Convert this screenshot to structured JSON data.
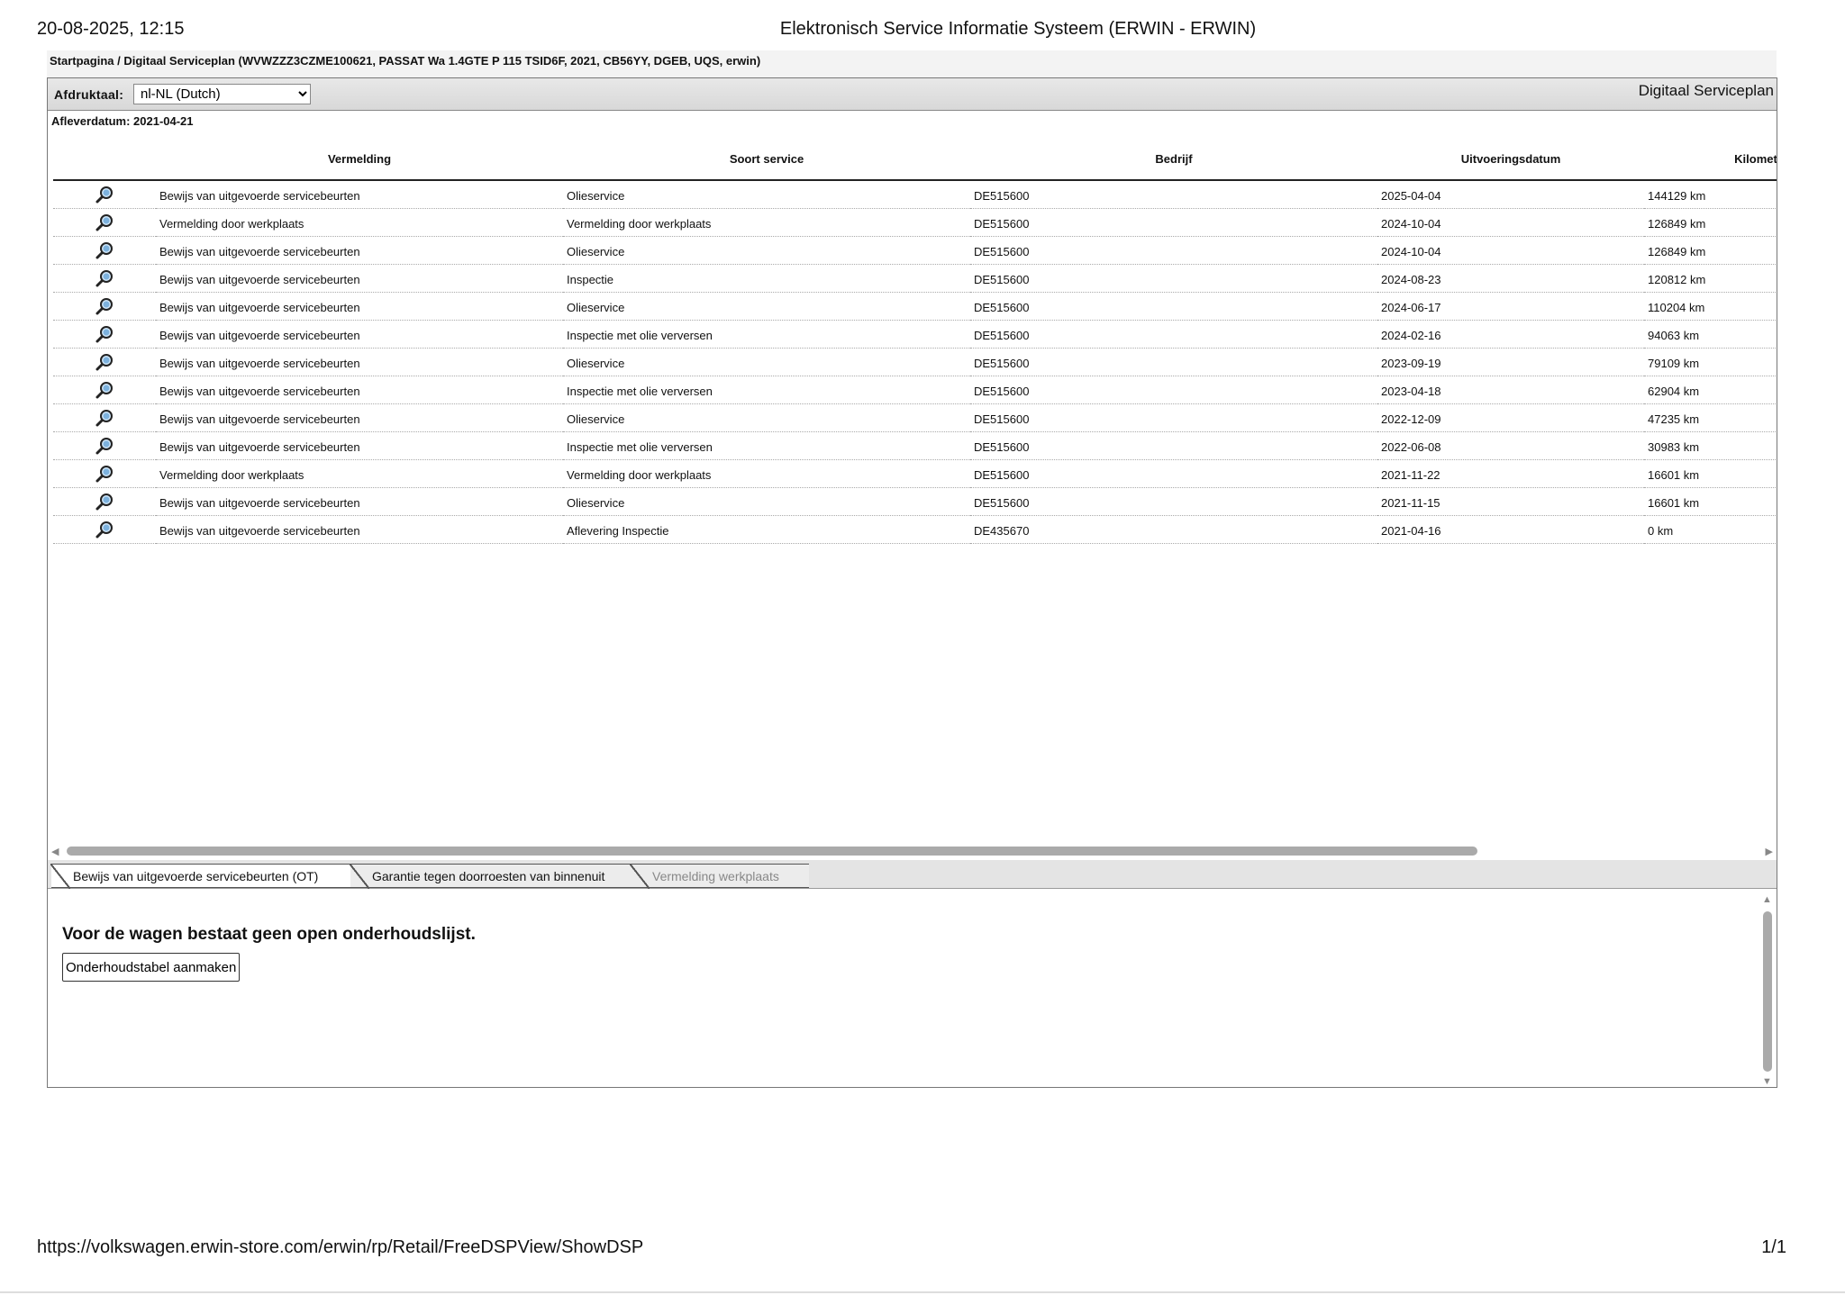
{
  "print_header": {
    "datetime": "20-08-2025, 12:15",
    "title": "Elektronisch Service Informatie Systeem (ERWIN - ERWIN)"
  },
  "breadcrumb": "Startpagina / Digitaal Serviceplan (WVWZZZ3CZME100621, PASSAT Wa 1.4GTE P 115 TSID6F, 2021, CB56YY, DGEB, UQS, erwin)",
  "toolbar": {
    "print_language_label": "Afdruktaal:",
    "print_language_value": "nl-NL (Dutch)",
    "panel_title": "Digitaal Serviceplan"
  },
  "delivery_date": "Afleverdatum: 2021-04-21",
  "table": {
    "columns": [
      "Vermelding",
      "Soort service",
      "Bedrijf",
      "Uitvoeringsdatum",
      "Kilometerstand"
    ],
    "rows": [
      {
        "entry": "Bewijs van uitgevoerde servicebeurten",
        "service_type": "Olieservice",
        "company": "DE515600",
        "date": "2025-04-04",
        "mileage": "144129 km"
      },
      {
        "entry": "Vermelding door werkplaats",
        "service_type": "Vermelding door werkplaats",
        "company": "DE515600",
        "date": "2024-10-04",
        "mileage": "126849 km"
      },
      {
        "entry": "Bewijs van uitgevoerde servicebeurten",
        "service_type": "Olieservice",
        "company": "DE515600",
        "date": "2024-10-04",
        "mileage": "126849 km"
      },
      {
        "entry": "Bewijs van uitgevoerde servicebeurten",
        "service_type": "Inspectie",
        "company": "DE515600",
        "date": "2024-08-23",
        "mileage": "120812 km"
      },
      {
        "entry": "Bewijs van uitgevoerde servicebeurten",
        "service_type": "Olieservice",
        "company": "DE515600",
        "date": "2024-06-17",
        "mileage": "110204 km"
      },
      {
        "entry": "Bewijs van uitgevoerde servicebeurten",
        "service_type": "Inspectie met olie verversen",
        "company": "DE515600",
        "date": "2024-02-16",
        "mileage": "94063 km"
      },
      {
        "entry": "Bewijs van uitgevoerde servicebeurten",
        "service_type": "Olieservice",
        "company": "DE515600",
        "date": "2023-09-19",
        "mileage": "79109 km"
      },
      {
        "entry": "Bewijs van uitgevoerde servicebeurten",
        "service_type": "Inspectie met olie verversen",
        "company": "DE515600",
        "date": "2023-04-18",
        "mileage": "62904 km"
      },
      {
        "entry": "Bewijs van uitgevoerde servicebeurten",
        "service_type": "Olieservice",
        "company": "DE515600",
        "date": "2022-12-09",
        "mileage": "47235 km"
      },
      {
        "entry": "Bewijs van uitgevoerde servicebeurten",
        "service_type": "Inspectie met olie verversen",
        "company": "DE515600",
        "date": "2022-06-08",
        "mileage": "30983 km"
      },
      {
        "entry": "Vermelding door werkplaats",
        "service_type": "Vermelding door werkplaats",
        "company": "DE515600",
        "date": "2021-11-22",
        "mileage": "16601 km"
      },
      {
        "entry": "Bewijs van uitgevoerde servicebeurten",
        "service_type": "Olieservice",
        "company": "DE515600",
        "date": "2021-11-15",
        "mileage": "16601 km"
      },
      {
        "entry": "Bewijs van uitgevoerde servicebeurten",
        "service_type": "Aflevering Inspectie",
        "company": "DE435670",
        "date": "2021-04-16",
        "mileage": "0 km"
      }
    ]
  },
  "tabs": [
    {
      "label": "Bewijs van uitgevoerde servicebeurten (OT)",
      "state": "active"
    },
    {
      "label": "Garantie tegen doorroesten van binnenuit",
      "state": "inactive"
    },
    {
      "label": "Vermelding werkplaats",
      "state": "disabled"
    }
  ],
  "lower_pane": {
    "message": "Voor de wagen bestaat geen open onderhoudslijst.",
    "create_button_label": "Onderhoudstabel aanmaken"
  },
  "print_footer": {
    "url": "https://volkswagen.erwin-store.com/erwin/rp/Retail/FreeDSPView/ShowDSP",
    "page": "1/1"
  },
  "icons": {
    "row_detail": "magnifier-icon",
    "select_arrow": "chevron-down-icon",
    "scroll_left": "arrow-left-icon",
    "scroll_right": "arrow-right-icon",
    "scroll_up": "arrow-up-icon",
    "scroll_down": "arrow-down-icon"
  },
  "colors": {
    "toolbar_bg": "#dddddd",
    "magnifier_lens": "#3a86c8"
  }
}
